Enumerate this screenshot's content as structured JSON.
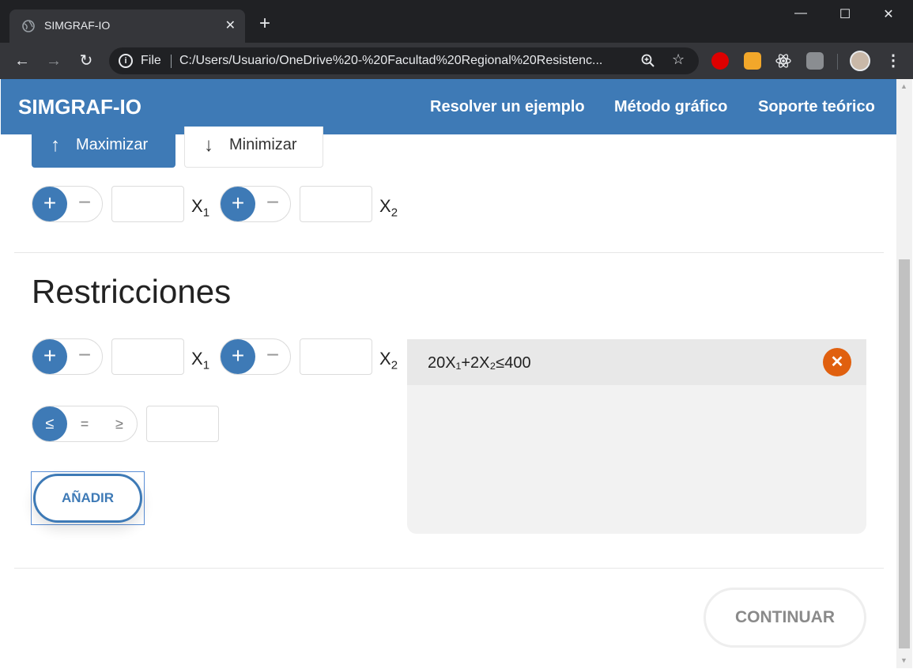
{
  "browser": {
    "tab_title": "SIMGRAF-IO",
    "tab_close": "✕",
    "new_tab": "+",
    "file_label": "File",
    "url": "C:/Users/Usuario/OneDrive%20-%20Facultad%20Regional%20Resistenc...",
    "window_controls": {
      "minimize": "—",
      "maximize": "☐",
      "close": "✕"
    }
  },
  "navbar": {
    "brand": "SIMGRAF-IO",
    "links": [
      "Resolver un ejemplo",
      "Método gráfico",
      "Soporte teórico"
    ]
  },
  "objective": {
    "maximize_label": "Maximizar",
    "minimize_label": "Minimizar",
    "selected": "Maximizar",
    "terms": [
      {
        "sign": "+",
        "alt_sign": "−",
        "value": "",
        "var": "X",
        "sub": "1"
      },
      {
        "sign": "+",
        "alt_sign": "−",
        "value": "",
        "var": "X",
        "sub": "2"
      }
    ]
  },
  "constraints": {
    "title": "Restricciones",
    "terms": [
      {
        "sign": "+",
        "alt_sign": "−",
        "value": "",
        "var": "X",
        "sub": "1"
      },
      {
        "sign": "+",
        "alt_sign": "−",
        "value": "",
        "var": "X",
        "sub": "2"
      }
    ],
    "relations": [
      "≤",
      "=",
      "≥"
    ],
    "selected_relation": "≤",
    "rhs_value": "",
    "add_button": "AÑADIR",
    "list": [
      {
        "text": "20X₁+2X₂≤400"
      }
    ]
  },
  "continue_button": "CONTINUAR",
  "colors": {
    "primary": "#3e7ab6",
    "danger": "#e0600f",
    "panel": "#f2f2f2"
  }
}
